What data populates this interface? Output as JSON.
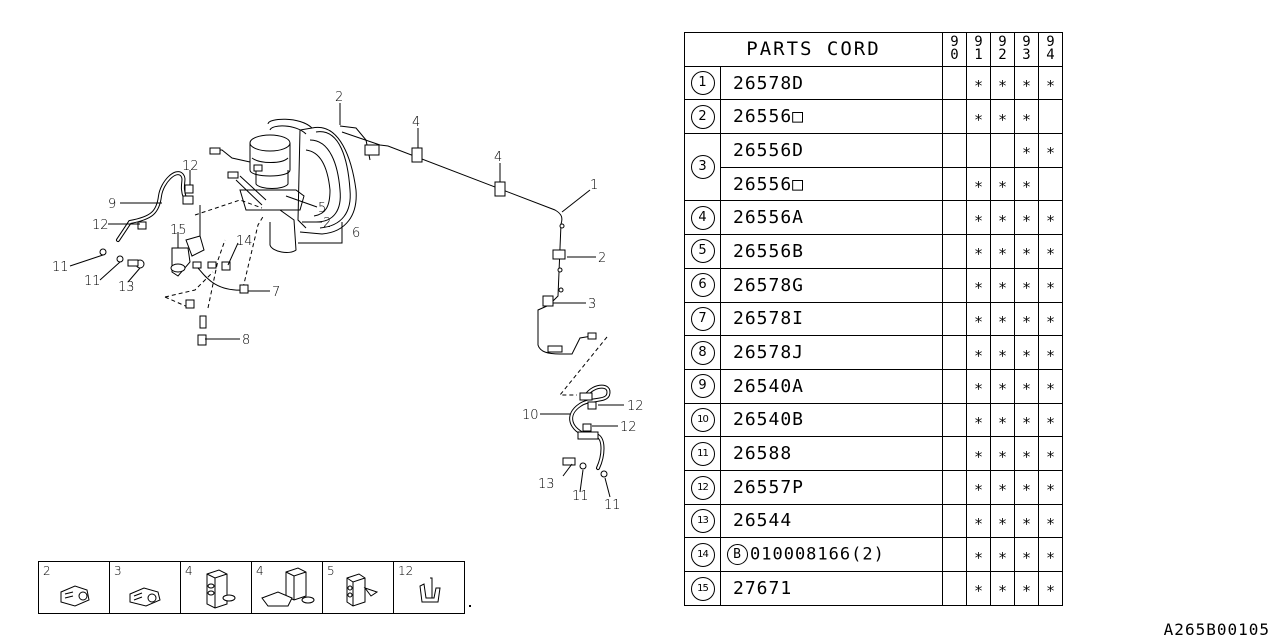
{
  "diagram": {
    "callouts": {
      "c1": "1",
      "c2a": "2",
      "c2b": "2",
      "c2c": "2",
      "c3": "3",
      "c4a": "4",
      "c4b": "4",
      "c5": "5",
      "c6": "6",
      "c7": "7",
      "c8": "8",
      "c9": "9",
      "c10": "10",
      "c11a": "11",
      "c11b": "11",
      "c11c": "11",
      "c11d": "11",
      "c12a": "12",
      "c12b": "12",
      "c12c": "12",
      "c12d": "12",
      "c13a": "13",
      "c13b": "13",
      "c14": "14",
      "c15": "15"
    }
  },
  "table": {
    "title": "PARTS CORD",
    "years": [
      {
        "top": "9",
        "bot": "0"
      },
      {
        "top": "9",
        "bot": "1"
      },
      {
        "top": "9",
        "bot": "2"
      },
      {
        "top": "9",
        "bot": "3"
      },
      {
        "top": "9",
        "bot": "4"
      }
    ],
    "mark": "∗",
    "rows": [
      {
        "no": "1",
        "code": "26578D",
        "marks": [
          "",
          "∗",
          "∗",
          "∗",
          "∗"
        ]
      },
      {
        "no": "2",
        "code": "26556□",
        "marks": [
          "",
          "∗",
          "∗",
          "∗",
          ""
        ]
      },
      {
        "no": "3",
        "code": "26556D",
        "marks": [
          "",
          "",
          "",
          "∗",
          "∗"
        ]
      },
      {
        "no": "3",
        "code": "26556□",
        "marks": [
          "",
          "∗",
          "∗",
          "∗",
          ""
        ]
      },
      {
        "no": "4",
        "code": "26556A",
        "marks": [
          "",
          "∗",
          "∗",
          "∗",
          "∗"
        ]
      },
      {
        "no": "5",
        "code": "26556B",
        "marks": [
          "",
          "∗",
          "∗",
          "∗",
          "∗"
        ]
      },
      {
        "no": "6",
        "code": "26578G",
        "marks": [
          "",
          "∗",
          "∗",
          "∗",
          "∗"
        ]
      },
      {
        "no": "7",
        "code": "26578I",
        "marks": [
          "",
          "∗",
          "∗",
          "∗",
          "∗"
        ]
      },
      {
        "no": "8",
        "code": "26578J",
        "marks": [
          "",
          "∗",
          "∗",
          "∗",
          "∗"
        ]
      },
      {
        "no": "9",
        "code": "26540A",
        "marks": [
          "",
          "∗",
          "∗",
          "∗",
          "∗"
        ]
      },
      {
        "no": "10",
        "code": "26540B",
        "marks": [
          "",
          "∗",
          "∗",
          "∗",
          "∗"
        ]
      },
      {
        "no": "11",
        "code": "26588",
        "marks": [
          "",
          "∗",
          "∗",
          "∗",
          "∗"
        ]
      },
      {
        "no": "12",
        "code": "26557P",
        "marks": [
          "",
          "∗",
          "∗",
          "∗",
          "∗"
        ]
      },
      {
        "no": "13",
        "code": "26544",
        "marks": [
          "",
          "∗",
          "∗",
          "∗",
          "∗"
        ]
      },
      {
        "no": "14",
        "prefix": "B",
        "code": "010008166(2)",
        "marks": [
          "",
          "∗",
          "∗",
          "∗",
          "∗"
        ]
      },
      {
        "no": "15",
        "code": "27671",
        "marks": [
          "",
          "∗",
          "∗",
          "∗",
          "∗"
        ]
      }
    ]
  },
  "clip_strip": {
    "cells": [
      {
        "label": "2",
        "icon": "clip-2-icon"
      },
      {
        "label": "3",
        "icon": "clip-3-icon"
      },
      {
        "label": "4",
        "icon": "clip-4a-icon"
      },
      {
        "label": "4",
        "icon": "clip-4b-icon"
      },
      {
        "label": "5",
        "icon": "clip-5-icon"
      },
      {
        "label": "12",
        "icon": "clip-12-icon"
      }
    ]
  },
  "drawing_code": "A265B00105"
}
